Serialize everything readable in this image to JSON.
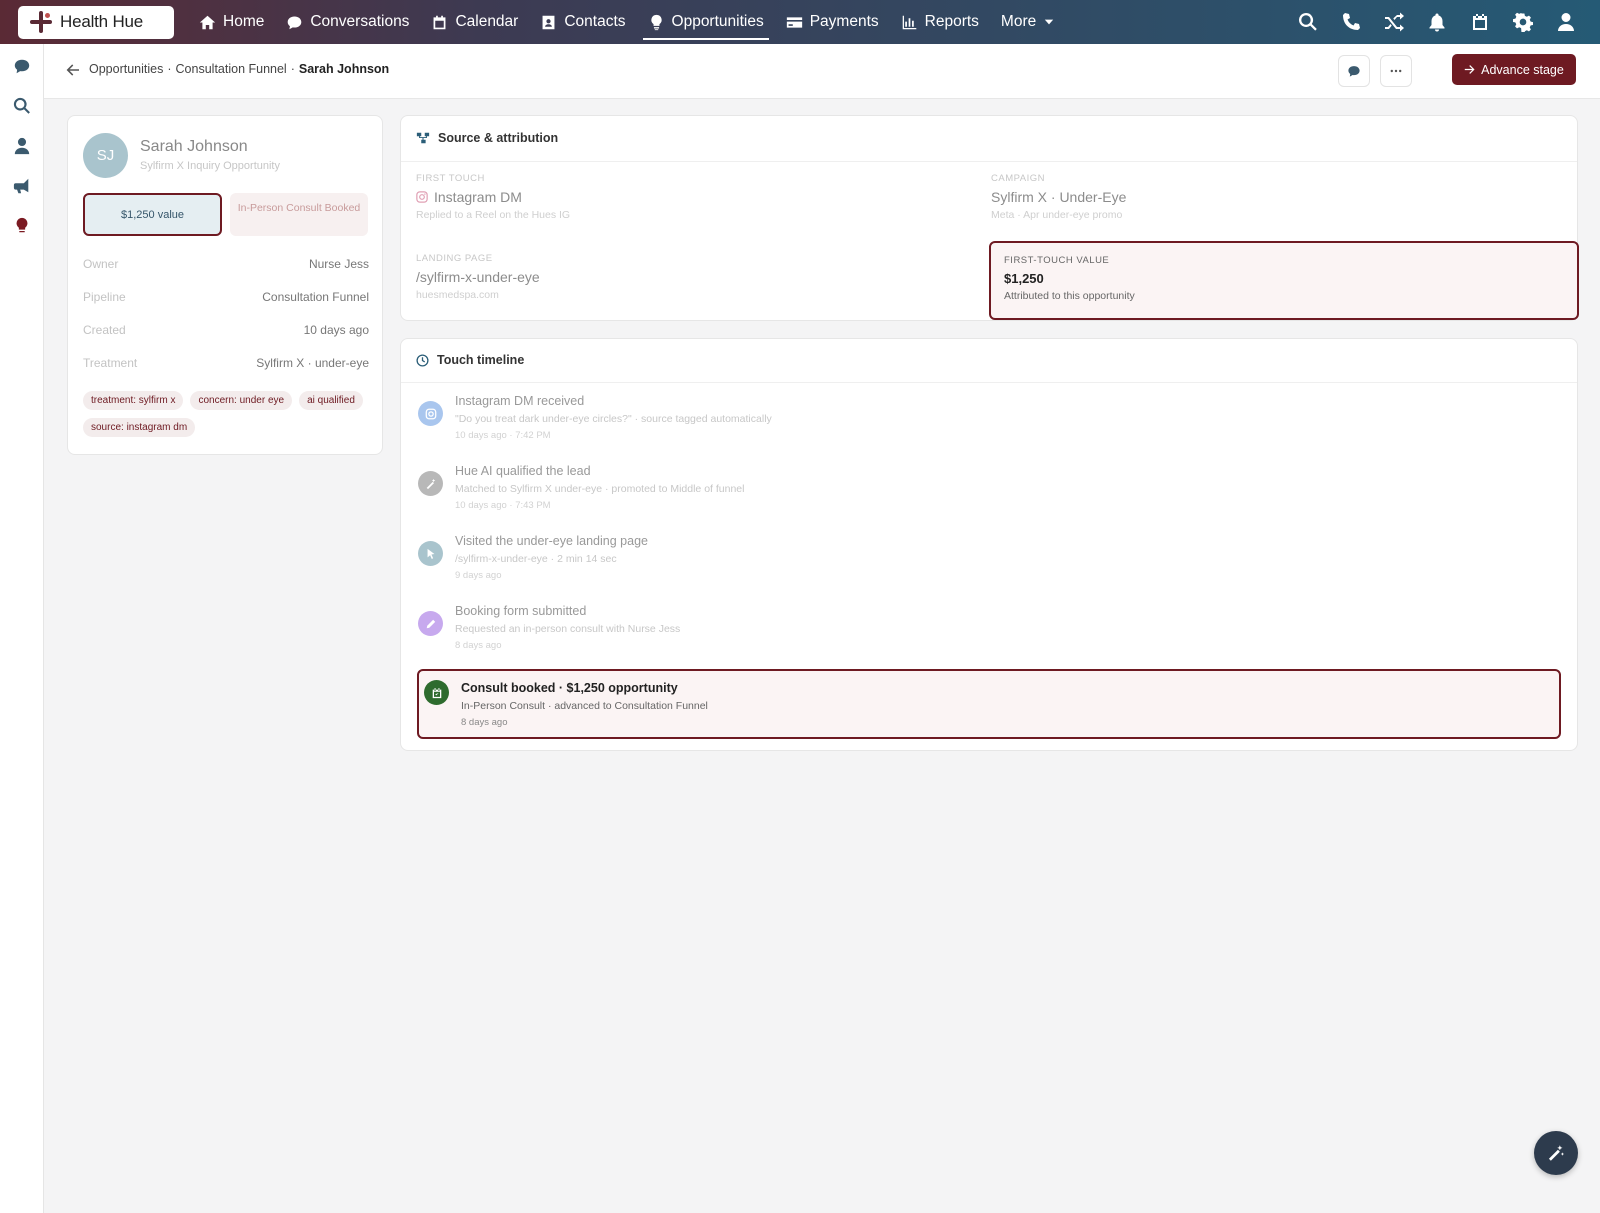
{
  "brand": {
    "name": "Health Hue"
  },
  "nav": {
    "items": [
      {
        "label": "Home",
        "icon": "home-icon"
      },
      {
        "label": "Conversations",
        "icon": "chat-icon"
      },
      {
        "label": "Calendar",
        "icon": "calendar-icon"
      },
      {
        "label": "Contacts",
        "icon": "contact-card-icon"
      },
      {
        "label": "Opportunities",
        "icon": "lightbulb-icon",
        "active": true
      },
      {
        "label": "Payments",
        "icon": "credit-card-icon"
      },
      {
        "label": "Reports",
        "icon": "bar-chart-icon"
      },
      {
        "label": "More",
        "icon": "caret-down-icon"
      }
    ],
    "right_icons": [
      "search-icon",
      "phone-icon",
      "shuffle-icon",
      "bell-icon",
      "calendar-icon",
      "gear-icon",
      "user-icon"
    ]
  },
  "rail": [
    "chat-icon",
    "search-icon",
    "user-icon",
    "megaphone-icon",
    "lightbulb-icon"
  ],
  "breadcrumb": {
    "part1": "Opportunities",
    "sep": "·",
    "part2": "Consultation Funnel",
    "current": "Sarah Johnson"
  },
  "header": {
    "advance_label": "Advance stage"
  },
  "profile": {
    "initials": "SJ",
    "name": "Sarah Johnson",
    "subtitle": "Sylfirm X Inquiry Opportunity",
    "value_pill": "$1,250 value",
    "stage_pill": "In-Person Consult Booked",
    "fields": [
      {
        "key": "Owner",
        "value": "Nurse Jess"
      },
      {
        "key": "Pipeline",
        "value": "Consultation Funnel"
      },
      {
        "key": "Created",
        "value": "10 days ago"
      },
      {
        "key": "Treatment",
        "value": "Sylfirm X · under-eye"
      }
    ],
    "tags": [
      "treatment: sylfirm x",
      "concern: under eye",
      "ai qualified",
      "source: instagram dm"
    ]
  },
  "source": {
    "title": "Source & attribution",
    "first_touch": {
      "label": "First touch",
      "value": "Instagram DM",
      "sub": "Replied to a Reel on the Hues IG"
    },
    "campaign": {
      "label": "Campaign",
      "value": "Sylfirm X · Under-Eye",
      "sub": "Meta · Apr under-eye promo"
    },
    "landing": {
      "label": "Landing page",
      "value": "/sylfirm-x-under-eye",
      "sub": "huesmedspa.com"
    },
    "ft_value": {
      "label": "First-touch value",
      "value": "$1,250",
      "sub": "Attributed to this opportunity"
    }
  },
  "timeline": {
    "title": "Touch timeline",
    "items": [
      {
        "title": "Instagram DM received",
        "desc": "\"Do you treat dark under-eye circles?\" · source tagged automatically",
        "time": "10 days ago · 7:42 PM",
        "color": "#a9c6ee",
        "icon": "instagram-icon"
      },
      {
        "title": "Hue AI qualified the lead",
        "desc": "Matched to Sylfirm X under-eye · promoted to Middle of funnel",
        "time": "10 days ago · 7:43 PM",
        "color": "#b8b8b8",
        "icon": "magic-wand-icon"
      },
      {
        "title": "Visited the under-eye landing page",
        "desc": "/sylfirm-x-under-eye · 2 min 14 sec",
        "time": "9 days ago",
        "color": "#a9c4cd",
        "icon": "cursor-icon"
      },
      {
        "title": "Booking form submitted",
        "desc": "Requested an in-person consult with Nurse Jess",
        "time": "8 days ago",
        "color": "#c7a9ee",
        "icon": "pencil-icon"
      },
      {
        "title": "Consult booked · $1,250 opportunity",
        "desc": "In-Person Consult · advanced to Consultation Funnel",
        "time": "8 days ago",
        "color": "#2e6b2e",
        "icon": "calendar-check-icon"
      }
    ]
  },
  "colors": {
    "accent": "#6e1a22",
    "nav_start": "#5a2a35",
    "nav_end": "#255a75"
  }
}
